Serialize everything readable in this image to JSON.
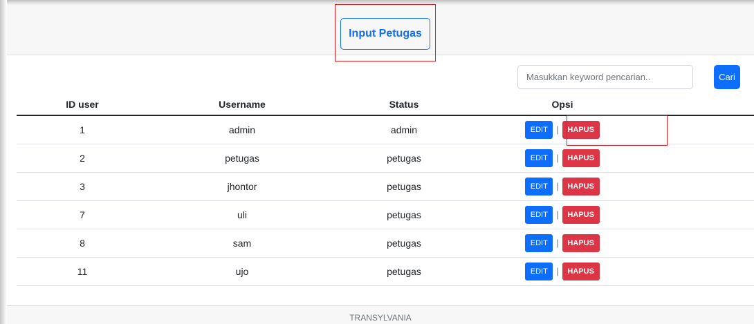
{
  "header": {
    "input_button_label": "Input Petugas"
  },
  "search": {
    "placeholder": "Masukkan keyword pencarian..",
    "button_label": "Cari"
  },
  "table": {
    "columns": [
      "ID user",
      "Username",
      "Status",
      "Opsi"
    ],
    "rows": [
      {
        "id": "1",
        "username": "admin",
        "status": "admin"
      },
      {
        "id": "2",
        "username": "petugas",
        "status": "petugas"
      },
      {
        "id": "3",
        "username": "jhontor",
        "status": "petugas"
      },
      {
        "id": "7",
        "username": "uli",
        "status": "petugas"
      },
      {
        "id": "8",
        "username": "sam",
        "status": "petugas"
      },
      {
        "id": "11",
        "username": "ujo",
        "status": "petugas"
      }
    ],
    "edit_label": "EDIT",
    "separator": "|",
    "delete_label": "HAPUS"
  },
  "footer": {
    "text": "TRANSYLVANIA"
  },
  "colors": {
    "primary": "#0d6efd",
    "danger": "#dc3545",
    "annotation": "#e02020"
  }
}
